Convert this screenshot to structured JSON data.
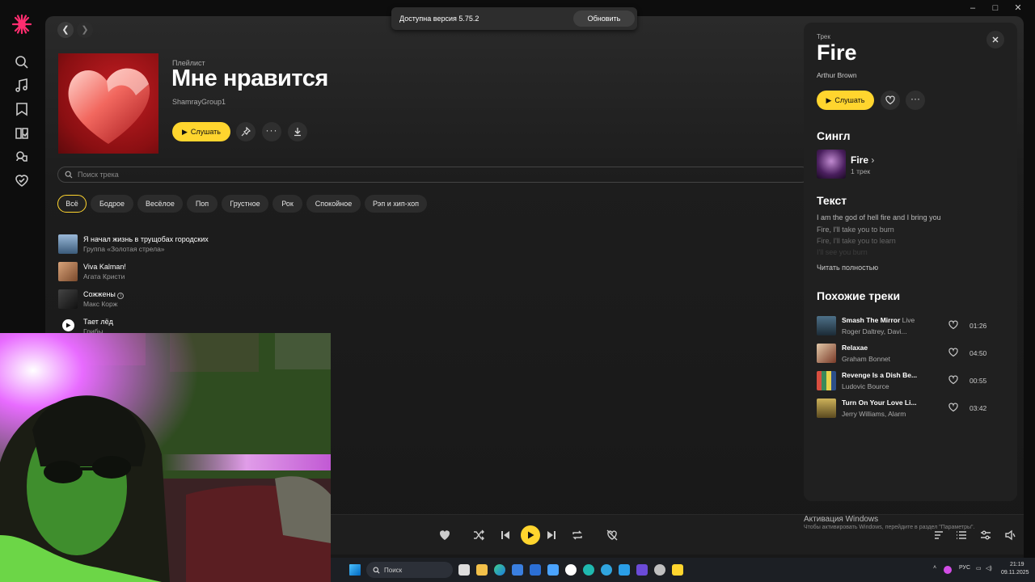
{
  "update_banner": {
    "text": "Доступна версия 5.75.2",
    "button": "Обновить"
  },
  "playlist": {
    "type_label": "Плейлист",
    "title": "Мне нравится",
    "owner": "ShamrayGroup1",
    "listen_label": "Слушать"
  },
  "search": {
    "placeholder": "Поиск трека"
  },
  "filters": [
    "Всё",
    "Бодрое",
    "Весёлое",
    "Поп",
    "Грустное",
    "Рок",
    "Спокойное",
    "Рэп и хип-хоп"
  ],
  "tracks": [
    {
      "title": "Я начал жизнь в трущобах городских",
      "artist": "Группа «Золотая стрела»"
    },
    {
      "title": "Viva Kalman!",
      "artist": "Агата Кристи"
    },
    {
      "title": "Сожжены",
      "artist": "Макс Корж"
    },
    {
      "title": "Тает лёд",
      "artist": "Грибы"
    }
  ],
  "side_panel": {
    "type_label": "Трек",
    "title": "Fire",
    "artist": "Arthur Brown",
    "listen_label": "Слушать",
    "single_heading": "Сингл",
    "single_title": "Fire",
    "single_count": "1 трек",
    "lyrics_heading": "Текст",
    "lyrics": [
      "I am the god of hell fire and I bring you",
      "Fire, I'll take you to burn",
      "Fire, I'll take you to learn",
      "I'll see you burn"
    ],
    "read_more": "Читать полностью",
    "similar_heading": "Похожие треки",
    "similar": [
      {
        "title": "Smash The Mirror",
        "tag": "Live",
        "artist": "Roger Daltrey, Davi...",
        "duration": "01:26"
      },
      {
        "title": "Relaxae",
        "tag": "",
        "artist": "Graham Bonnet",
        "duration": "04:50"
      },
      {
        "title": "Revenge Is a Dish Be...",
        "tag": "",
        "artist": "Ludovic Bource",
        "duration": "00:55"
      },
      {
        "title": "Turn On Your Love Li...",
        "tag": "",
        "artist": "Jerry Williams, Alarm",
        "duration": "03:42"
      }
    ]
  },
  "windows_activation": {
    "title": "Активация Windows",
    "subtitle": "Чтобы активировать Windows, перейдите в раздел \"Параметры\"."
  },
  "taskbar": {
    "search_label": "Поиск",
    "language": "РУС",
    "time": "21:19",
    "date": "09.11.2025"
  },
  "colors": {
    "accent": "#ffd52e",
    "background": "#181818",
    "panel": "#202020"
  }
}
